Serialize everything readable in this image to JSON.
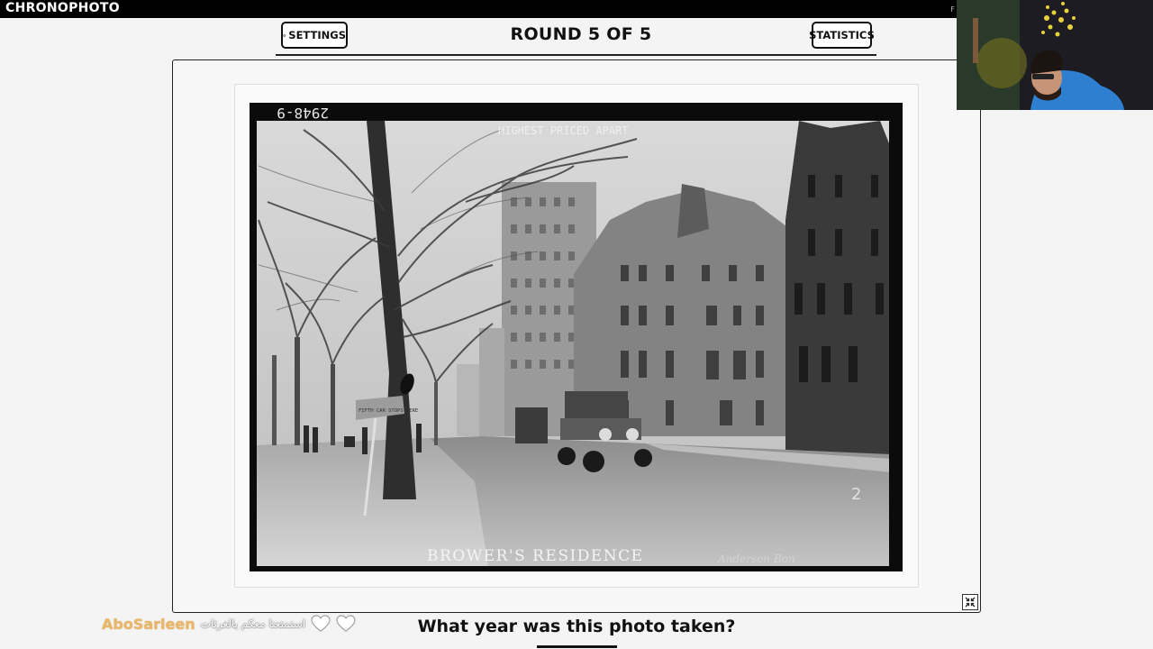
{
  "app": {
    "logo": "CHRONOPHOTO",
    "topbar_edge_letter": "F"
  },
  "header": {
    "settings_label": "SETTINGS",
    "settings_icon": "gear-icon",
    "round_title": "ROUND 5 OF 5",
    "statistics_label": "STATISTICS"
  },
  "photo": {
    "plate_number": "2948-9",
    "top_caption": "HIGHEST PRICED APART",
    "bottom_caption": "BROWER'S RESIDENCE",
    "bottom_faint_text": "Anderson Bon",
    "corner_mark": "2",
    "sign_text": "FIFTH CAR STOPS HERE"
  },
  "question": "What year was this photo taken?",
  "chat": {
    "username": "AboSarleen",
    "message": "استمتعنا معكم يالغرثات"
  },
  "colors": {
    "accent": "#111111",
    "chat_username": "#e9b76b",
    "background": "#f4f4f4"
  }
}
